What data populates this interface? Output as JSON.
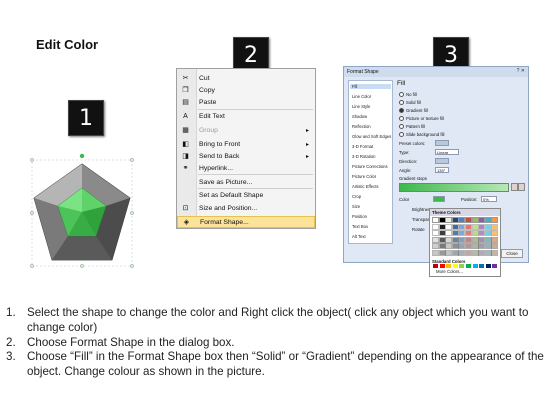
{
  "title": "Edit Color",
  "badges": [
    "1",
    "2",
    "3"
  ],
  "context_menu": {
    "items": [
      {
        "label": "Cut",
        "icon": "scissors-icon",
        "glyph": "✂",
        "disabled": false,
        "submenu": false
      },
      {
        "label": "Copy",
        "icon": "copy-icon",
        "glyph": "❐",
        "disabled": false,
        "submenu": false
      },
      {
        "label": "Paste",
        "icon": "paste-icon",
        "glyph": "▤",
        "disabled": false,
        "submenu": false
      },
      {
        "label": "Edit Text",
        "icon": "edit-text-icon",
        "glyph": "A",
        "disabled": false,
        "submenu": false
      },
      {
        "label": "Group",
        "icon": "group-icon",
        "glyph": "▦",
        "disabled": true,
        "submenu": true
      },
      {
        "label": "Bring to Front",
        "icon": "bring-front-icon",
        "glyph": "◧",
        "disabled": false,
        "submenu": true
      },
      {
        "label": "Send to Back",
        "icon": "send-back-icon",
        "glyph": "◨",
        "disabled": false,
        "submenu": true
      },
      {
        "label": "Hyperlink...",
        "icon": "hyperlink-icon",
        "glyph": "⚭",
        "disabled": false,
        "submenu": false
      },
      {
        "label": "Save as Picture...",
        "icon": "",
        "glyph": "",
        "disabled": false,
        "submenu": false
      },
      {
        "label": "Set as Default Shape",
        "icon": "",
        "glyph": "",
        "disabled": false,
        "submenu": false
      },
      {
        "label": "Size and Position...",
        "icon": "size-position-icon",
        "glyph": "⊡",
        "disabled": false,
        "submenu": false
      },
      {
        "label": "Format Shape...",
        "icon": "format-shape-icon",
        "glyph": "◈",
        "disabled": false,
        "submenu": false,
        "highlighted": true
      }
    ]
  },
  "dialog": {
    "title": "Format Shape",
    "window_controls": "? ✕",
    "categories": [
      "Fill",
      "Line Color",
      "Line Style",
      "Shadow",
      "Reflection",
      "Glow and Soft Edges",
      "3-D Format",
      "3-D Rotation",
      "Picture Corrections",
      "Picture Color",
      "Artistic Effects",
      "Crop",
      "Size",
      "Position",
      "Text Box",
      "Alt Text"
    ],
    "heading": "Fill",
    "fill_options": [
      "No fill",
      "Solid fill",
      "Gradient fill",
      "Picture or texture fill",
      "Pattern fill",
      "Slide background fill"
    ],
    "selected_fill": "Gradient fill",
    "preset_colors_label": "Preset colors:",
    "type_label": "Type:",
    "type_value": "Linear",
    "direction_label": "Direction:",
    "angle_label": "Angle:",
    "angle_value": "135°",
    "gradient_stops_label": "Gradient stops",
    "color_label": "Color",
    "position_label": "Position:",
    "position_value": "0%",
    "brightness_label": "Brightness",
    "transparency_label": "Transparenc",
    "rotate_label": "Rotate",
    "close_label": "Close"
  },
  "palette": {
    "theme_header": "Theme Colors",
    "standard_header": "Standard Colors",
    "more_colors": "More Colors...",
    "theme_top": [
      "#ffffff",
      "#000000",
      "#eeece1",
      "#1f497d",
      "#4f81bd",
      "#c0504d",
      "#9bbb59",
      "#8064a2",
      "#4bacc6",
      "#f79646"
    ],
    "standard": [
      "#c00000",
      "#ff0000",
      "#ffc000",
      "#ffff00",
      "#92d050",
      "#00b050",
      "#00b0f0",
      "#0070c0",
      "#002060",
      "#7030a0"
    ]
  },
  "colors": {
    "accent_green": "#3db84a",
    "highlight": "#fbe39a"
  },
  "steps": [
    {
      "num": "1.",
      "text": "Select the shape to change the color and Right click the object( click any object which you want to change color)"
    },
    {
      "num": "2.",
      "text": "Choose Format Shape in the dialog box."
    },
    {
      "num": "3.",
      "text": "Choose “Fill” in the Format Shape box then “Solid” or “Gradient” depending on the appearance of the object. Change colour as shown in the picture."
    }
  ]
}
